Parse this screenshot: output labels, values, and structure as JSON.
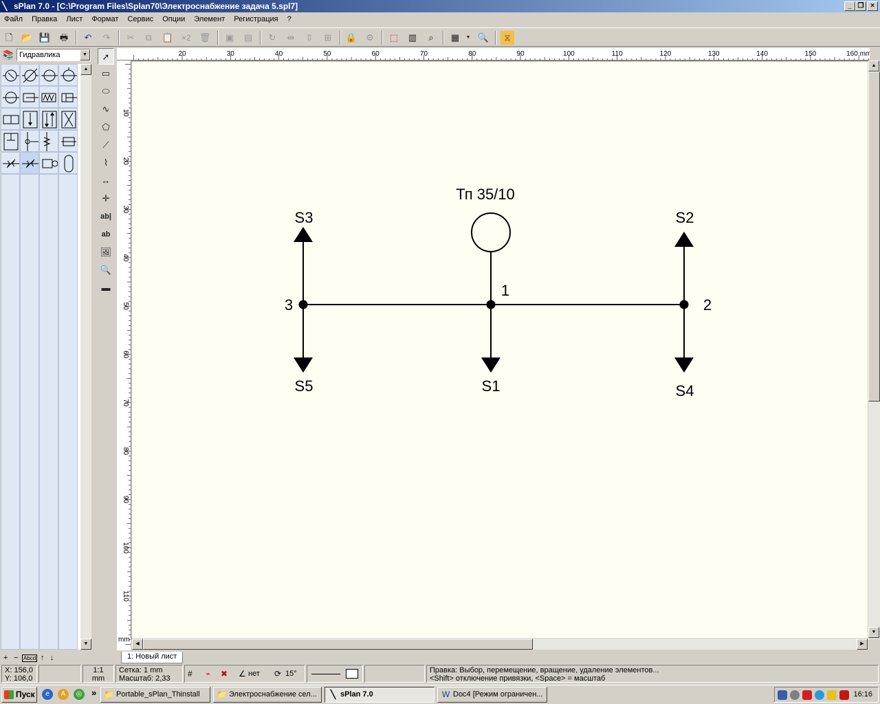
{
  "window": {
    "title": "sPlan 7.0 - [C:\\Program Files\\Splan70\\Электроснабжение задача 5.spl7]"
  },
  "menu": [
    "Файл",
    "Правка",
    "Лист",
    "Формат",
    "Сервис",
    "Опции",
    "Элемент",
    "Регистрация",
    "?"
  ],
  "toolbar": {
    "copies_label": "×2"
  },
  "library": {
    "selected": "Гидравлика",
    "bottom_controls": [
      "+",
      "−",
      "Abcd",
      "↑",
      "↓"
    ]
  },
  "rulers": {
    "h_ticks": [
      "20",
      "30",
      "40",
      "50",
      "60",
      "70",
      "80",
      "90",
      "100",
      "110",
      "120",
      "130",
      "140",
      "150",
      "160 mm"
    ],
    "v_ticks": [
      "10",
      "20",
      "30",
      "40",
      "50",
      "60",
      "70",
      "80",
      "90",
      "100",
      "110"
    ],
    "unit": "mm"
  },
  "diagram": {
    "source_label": "Тп 35/10",
    "nodes": {
      "n1": "1",
      "n2": "2",
      "n3": "3"
    },
    "loads": {
      "s1": "S1",
      "s2": "S2",
      "s3": "S3",
      "s4": "S4",
      "s5": "S5"
    }
  },
  "sheet_tab": "1: Новый лист",
  "status": {
    "x": "X: 156,0",
    "y": "Y: 106,0",
    "scale_ratio": "1:1",
    "scale_unit": "mm",
    "grid": "Сетка: 1 mm",
    "zoom": "Масштаб:   2,33",
    "snap": "нет",
    "angle": "15°",
    "hint_line1": "Правка: Выбор, перемещение, вращение, удаление элементов...",
    "hint_line2": "<Shift> отключение привязки, <Space> = масштаб"
  },
  "taskbar": {
    "start": "Пуск",
    "more": "»",
    "buttons": [
      {
        "label": "Portable_sPlan_Thinstall",
        "active": false
      },
      {
        "label": "Электроснабжение сел...",
        "active": false
      },
      {
        "label": "sPlan 7.0",
        "active": true
      },
      {
        "label": "Doc4 [Режим ограничен...",
        "active": false
      }
    ],
    "clock": "16:16"
  }
}
